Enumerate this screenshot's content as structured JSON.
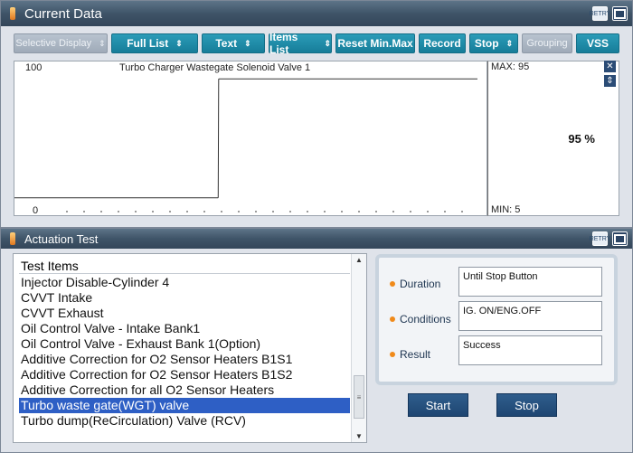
{
  "current_data": {
    "title": "Current Data",
    "toolbar": [
      {
        "label": "Selective Display",
        "has_chevron": true,
        "disabled": true
      },
      {
        "label": "Full List",
        "has_chevron": true,
        "disabled": false
      },
      {
        "label": "Text",
        "has_chevron": true,
        "disabled": false
      },
      {
        "label": "Items List",
        "has_chevron": true,
        "disabled": false
      },
      {
        "label": "Reset Min.Max",
        "has_chevron": false,
        "disabled": false
      },
      {
        "label": "Record",
        "has_chevron": false,
        "disabled": false
      },
      {
        "label": "Stop",
        "has_chevron": true,
        "disabled": false
      },
      {
        "label": "Grouping",
        "has_chevron": false,
        "disabled": true
      },
      {
        "label": "VSS",
        "has_chevron": false,
        "disabled": false
      }
    ],
    "graph": {
      "y_top_label": "100",
      "y_bottom_label": "0",
      "series_title": "Turbo Charger Wastegate Solenoid Valve 1",
      "max_label": "MAX: 95",
      "min_label": "MIN: 5",
      "current_value": "95 %"
    },
    "chart_data": {
      "type": "line",
      "title": "Turbo Charger Wastegate Solenoid Valve 1",
      "ylim": [
        0,
        100
      ],
      "x": [
        0,
        44,
        44.1,
        100
      ],
      "y": [
        5,
        5,
        95,
        95
      ],
      "max": 95,
      "min": 5,
      "current": 95,
      "unit": "%"
    }
  },
  "actuation": {
    "title": "Actuation Test",
    "list_header": "Test Items",
    "items": [
      "Injector Disable-Cylinder 4",
      "CVVT Intake",
      "CVVT Exhaust",
      "Oil Control Valve - Intake Bank1",
      "Oil Control Valve - Exhaust Bank 1(Option)",
      "Additive Correction for O2 Sensor Heaters B1S1",
      "Additive Correction for O2 Sensor Heaters B1S2",
      "Additive Correction for all O2 Sensor Heaters",
      "Turbo waste gate(WGT) valve",
      "Turbo dump(ReCirculation) Valve (RCV)"
    ],
    "selected_index": 8,
    "info": {
      "duration_label": "Duration",
      "duration_value": "Until Stop Button",
      "conditions_label": "Conditions",
      "conditions_value": "IG. ON/ENG.OFF",
      "result_label": "Result",
      "result_value": "Success"
    },
    "start_label": "Start",
    "stop_label": "Stop"
  }
}
